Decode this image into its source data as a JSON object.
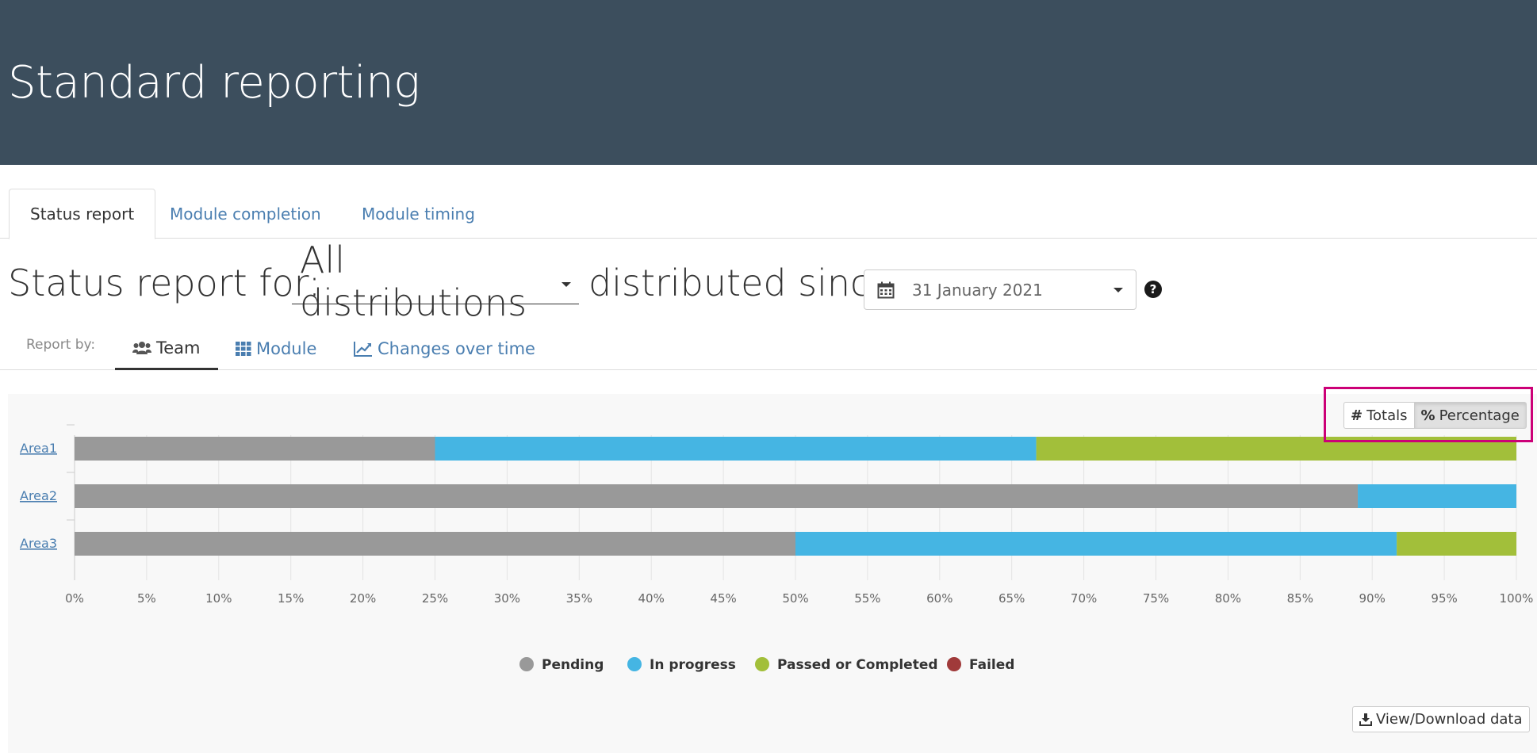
{
  "header": {
    "title": "Standard reporting"
  },
  "tabs": [
    {
      "label": "Status report",
      "active": true
    },
    {
      "label": "Module completion",
      "active": false
    },
    {
      "label": "Module timing",
      "active": false
    }
  ],
  "status": {
    "prefix": "Status report for:",
    "distribution": "All distributions",
    "since_label": "distributed since",
    "date": "31 January 2021"
  },
  "report_by": {
    "label": "Report by:",
    "options": [
      {
        "label": "Team",
        "icon": "users-icon",
        "active": true
      },
      {
        "label": "Module",
        "icon": "grid-icon",
        "active": false
      },
      {
        "label": "Changes over time",
        "icon": "line-chart-icon",
        "active": false
      }
    ]
  },
  "toggle": {
    "totals_label": "Totals",
    "percentage_label": "Percentage",
    "selected": "percentage"
  },
  "download": {
    "label": "View/Download data"
  },
  "colors": {
    "pending": "#999999",
    "in_progress": "#45b5e3",
    "passed": "#a2bf3a",
    "failed": "#a03a3a",
    "header_bg": "#3c4e5d",
    "link": "#4a7eb0",
    "highlight": "#cc0077"
  },
  "chart_data": {
    "type": "bar",
    "orientation": "horizontal",
    "stacked": true,
    "categories": [
      "Area1",
      "Area2",
      "Area3"
    ],
    "series": [
      {
        "name": "Pending",
        "values": [
          25,
          89,
          50
        ]
      },
      {
        "name": "In progress",
        "values": [
          41.7,
          11,
          41.7
        ]
      },
      {
        "name": "Passed or Completed",
        "values": [
          33.3,
          0,
          8.3
        ]
      },
      {
        "name": "Failed",
        "values": [
          0,
          0,
          0
        ]
      }
    ],
    "x_ticks": [
      "0%",
      "5%",
      "10%",
      "15%",
      "20%",
      "25%",
      "30%",
      "35%",
      "40%",
      "45%",
      "50%",
      "55%",
      "60%",
      "65%",
      "70%",
      "75%",
      "80%",
      "85%",
      "90%",
      "95%",
      "100%"
    ],
    "xlim": [
      0,
      100
    ],
    "grid": true,
    "legend": "bottom"
  }
}
